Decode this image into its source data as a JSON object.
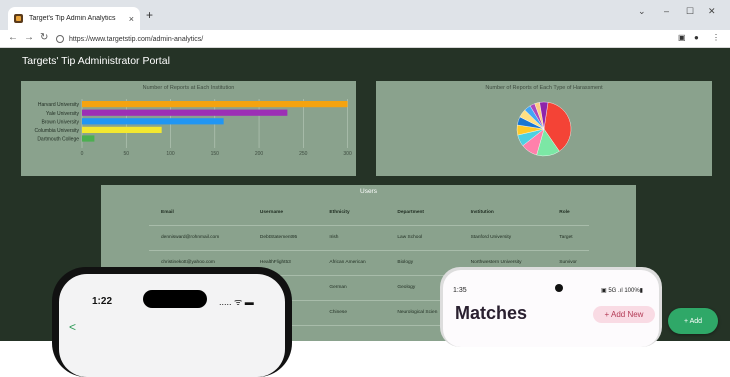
{
  "browser": {
    "tab_title": "Target's Tip Admin Analytics",
    "tab_close": "×",
    "new_tab": "+",
    "url": "https://www.targetstip.com/admin-analytics/",
    "min_icon": "–",
    "max_icon": "☐",
    "close_icon": "✕",
    "chevron": "⌄"
  },
  "portal": {
    "title": "Targets' Tip Administrator Portal"
  },
  "chart_data": [
    {
      "type": "bar",
      "orientation": "horizontal",
      "title": "Number of Reports at Each Institution",
      "categories": [
        "Harvard University",
        "Yale University",
        "Brown University",
        "Columbia University",
        "Dartmouth College"
      ],
      "values": [
        300,
        232,
        160,
        90,
        14
      ],
      "colors": [
        "#f5a30f",
        "#9c2fb5",
        "#2196f3",
        "#f3e82f",
        "#4caf50"
      ],
      "xticks": [
        0,
        50,
        100,
        150,
        200,
        250,
        300
      ],
      "xlim": [
        0,
        305
      ],
      "grid": true
    },
    {
      "type": "pie",
      "title": "Number of Reports of Each Type of Harassment",
      "values": [
        38,
        14,
        10,
        7,
        6,
        5,
        5,
        4,
        3,
        3,
        5
      ],
      "colors": [
        "#f44336",
        "#7ce7a5",
        "#ff80ab",
        "#4dd0e1",
        "#ffca28",
        "#1976d2",
        "#ffe082",
        "#42a5f5",
        "#ab47bc",
        "#ffcc80",
        "#8e24aa"
      ]
    }
  ],
  "users": {
    "title": "Users",
    "columns": [
      "Email",
      "Username",
      "Ethnicity",
      "Department",
      "Institution",
      "Role"
    ],
    "rows": [
      [
        "dennisward@rohnmail.com",
        "DebtStatement95",
        "Irish",
        "Law School",
        "Stanford University",
        "Target"
      ],
      [
        "christinekott@yahoo.com",
        "HealthFlight53",
        "African American",
        "Biology",
        "Northwestern University",
        "Survivor"
      ],
      [
        "",
        "Phone96",
        "German",
        "Geology",
        "",
        ""
      ],
      [
        "",
        "",
        "Chinese",
        "Neurological Scien",
        "",
        ""
      ]
    ]
  },
  "phone_ios": {
    "time": "1:22",
    "status": "..... ᯤ ▬",
    "back": "<"
  },
  "phone_android": {
    "time": "1:35",
    "status": "▣ 5G .ıl 100%▮",
    "heading": "Matches",
    "add_new": "+ Add New"
  },
  "fab": {
    "label": "+  Add"
  }
}
